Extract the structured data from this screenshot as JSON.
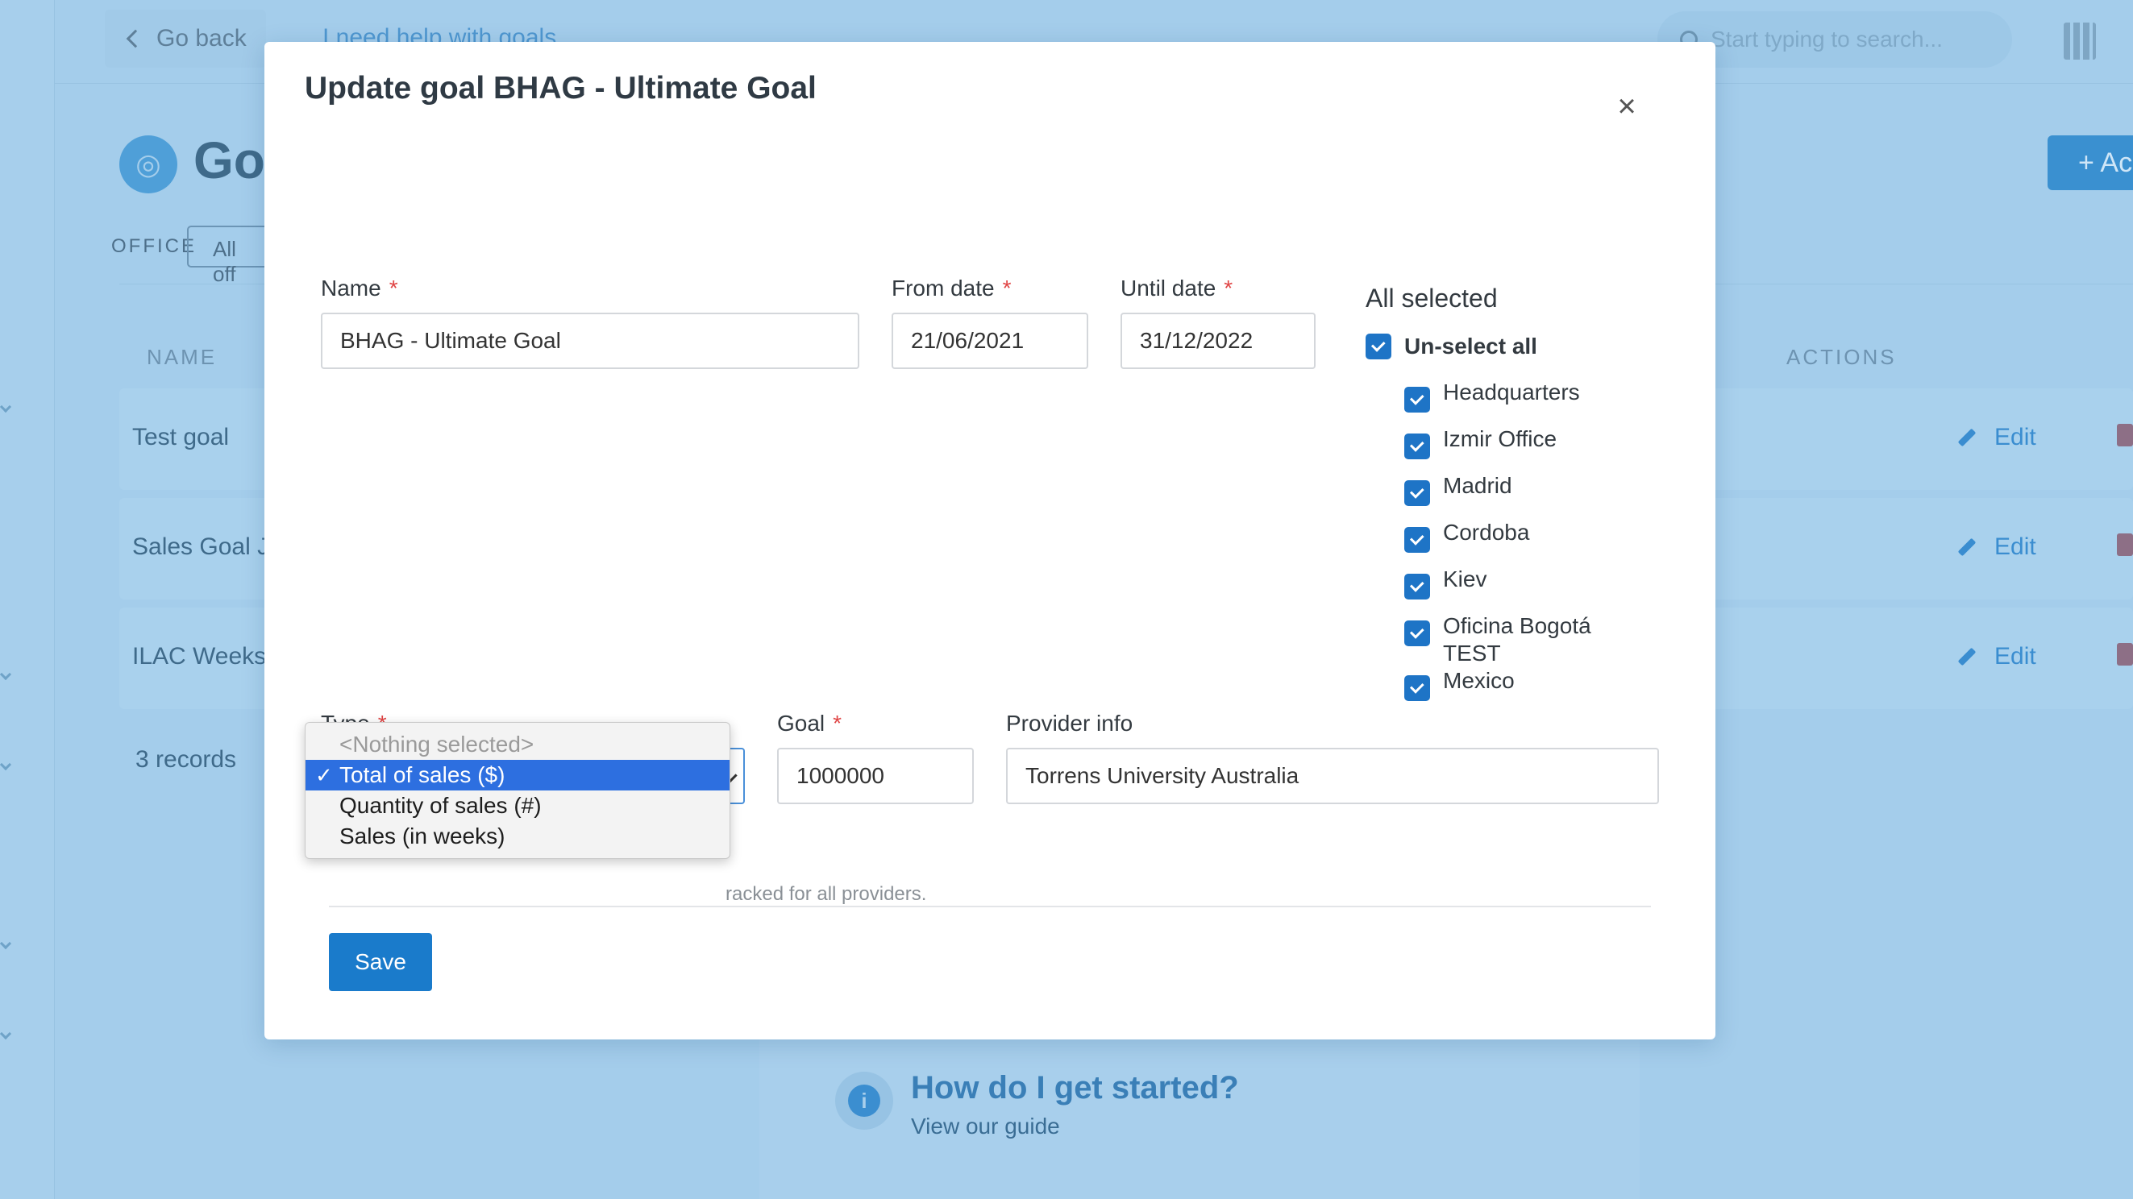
{
  "background": {
    "go_back": "Go back",
    "help_link": "I need help with goals",
    "search_placeholder": "Start typing to search...",
    "page_title": "Goa",
    "add_button": "+ Ac",
    "office_label": "OFFICE",
    "office_filter_value": "All off",
    "columns": {
      "name": "NAME",
      "actions": "ACTIONS"
    },
    "rows": [
      {
        "name": "Test goal",
        "action": "Edit"
      },
      {
        "name": "Sales Goal Ju",
        "action": "Edit"
      },
      {
        "name": "ILAC Weeks",
        "action": "Edit"
      }
    ],
    "records": "3 records",
    "help": {
      "title": "How do I get started?",
      "subtitle": "View our guide"
    }
  },
  "modal": {
    "title": "Update goal BHAG - Ultimate Goal",
    "close_symbol": "×",
    "required_mark": "*",
    "name": {
      "label": "Name",
      "value": "BHAG - Ultimate Goal"
    },
    "from_date": {
      "label": "From date",
      "value": "21/06/2021"
    },
    "until_date": {
      "label": "Until date",
      "value": "31/12/2022"
    },
    "offices": {
      "title": "All selected",
      "unselect_all": "Un-select all",
      "items": [
        "Headquarters",
        "Izmir Office",
        "Madrid",
        "Cordoba",
        "Kiev",
        "Oficina Bogotá TEST",
        "Mexico"
      ]
    },
    "type": {
      "label": "Type"
    },
    "goal": {
      "label": "Goal",
      "value": "1000000"
    },
    "provider_info": {
      "label": "Provider info",
      "value": "Torrens University Australia"
    },
    "hint_visible": "racked for all providers.",
    "save": "Save"
  },
  "type_dropdown": {
    "options": [
      "<Nothing selected>",
      "Total of sales ($)",
      "Quantity of sales (#)",
      "Sales (in weeks)"
    ],
    "selected": "Total of sales ($)",
    "check_symbol": "✓"
  },
  "colors": {
    "accent": "#1a7bcb",
    "checkbox": "#1e74c6",
    "highlight": "#2d6fe0",
    "required": "#e04545",
    "overlay": "#a4cdeb"
  }
}
